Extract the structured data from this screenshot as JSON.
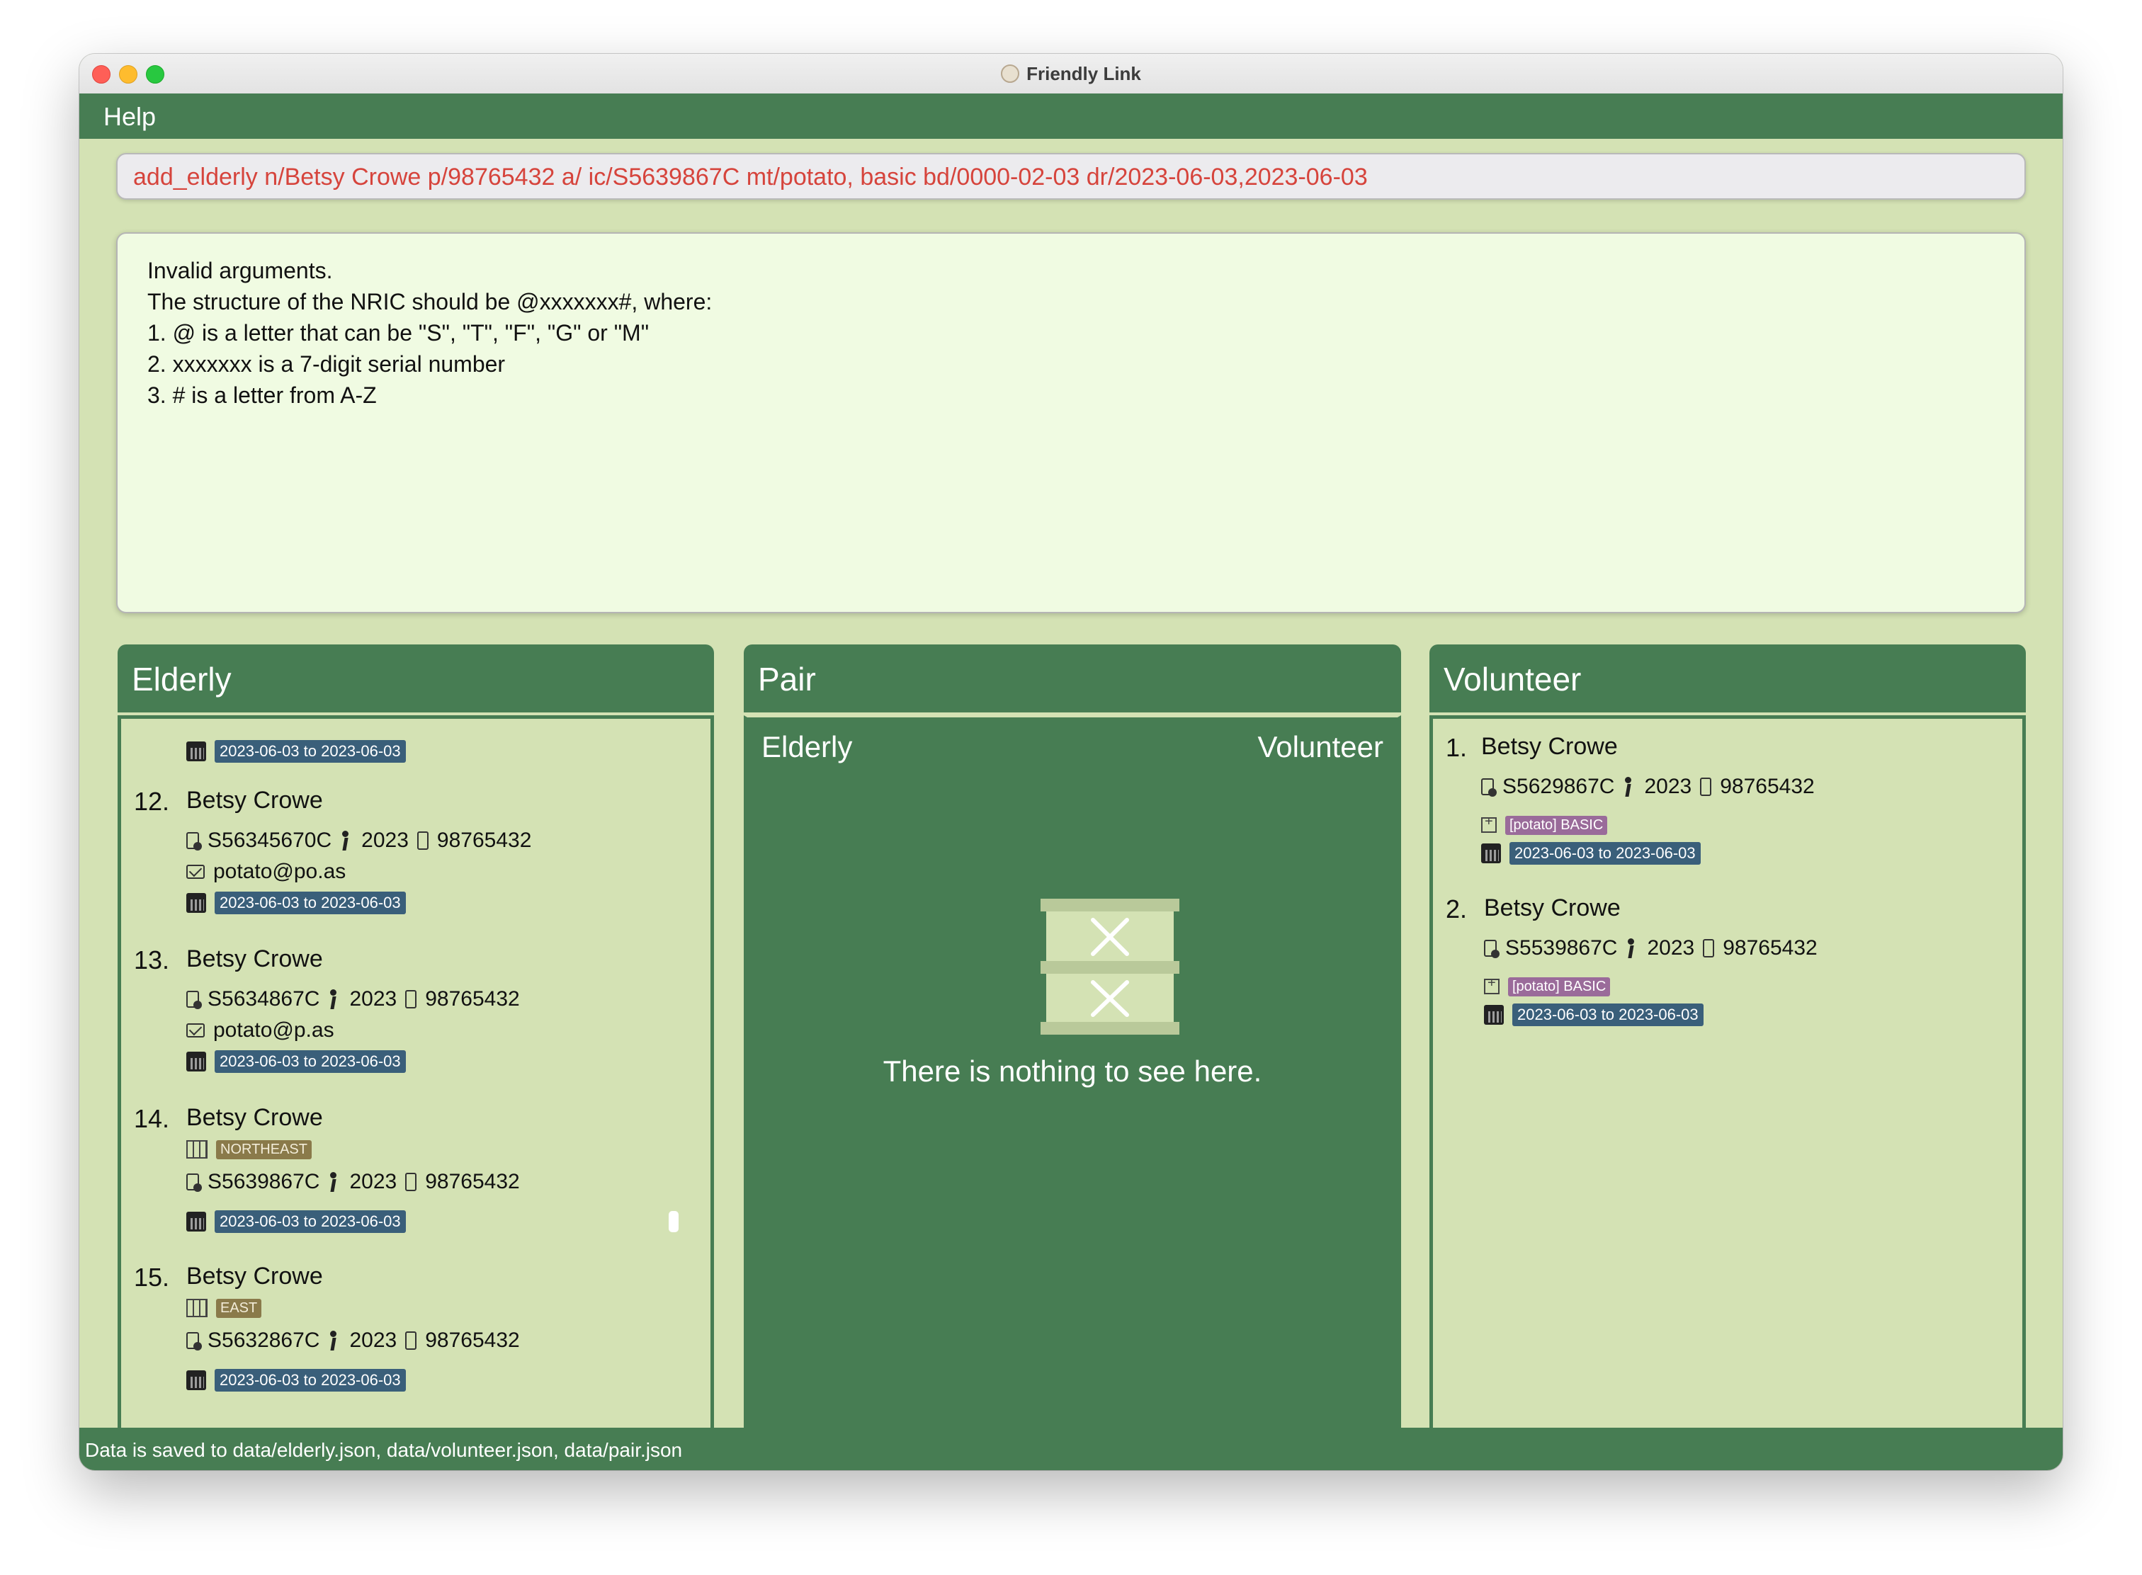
{
  "window": {
    "title": "Friendly Link"
  },
  "menu": {
    "help": "Help"
  },
  "command": {
    "value": "add_elderly n/Betsy Crowe p/98765432 a/ ic/S5639867C mt/potato, basic bd/0000-02-03 dr/2023-06-03,2023-06-03"
  },
  "result": {
    "text": "Invalid arguments.\nThe structure of the NRIC should be @xxxxxxx#, where:\n1. @ is a letter that can be \"S\", \"T\", \"F\", \"G\" or \"M\"\n2. xxxxxxx is a 7-digit serial number\n3. # is a letter from A-Z"
  },
  "elderly_panel": {
    "title": "Elderly",
    "partial_entry": {
      "date_range": "2023-06-03 to 2023-06-03"
    },
    "entries": [
      {
        "index": "12.",
        "name": "Betsy Crowe",
        "nric": "S56345670C",
        "age": "2023",
        "phone": "98765432",
        "email": "potato@po.as",
        "date_range": "2023-06-03 to 2023-06-03"
      },
      {
        "index": "13.",
        "name": "Betsy Crowe",
        "nric": "S5634867C",
        "age": "2023",
        "phone": "98765432",
        "email": "potato@p.as",
        "date_range": "2023-06-03 to 2023-06-03"
      },
      {
        "index": "14.",
        "name": "Betsy Crowe",
        "region": "NORTHEAST",
        "nric": "S5639867C",
        "age": "2023",
        "phone": "98765432",
        "date_range": "2023-06-03 to 2023-06-03"
      },
      {
        "index": "15.",
        "name": "Betsy Crowe",
        "region": "EAST",
        "nric": "S5632867C",
        "age": "2023",
        "phone": "98765432",
        "date_range": "2023-06-03 to 2023-06-03"
      }
    ]
  },
  "pair_panel": {
    "title": "Pair",
    "col_elderly": "Elderly",
    "col_volunteer": "Volunteer",
    "empty_icon": "empty-box-icon",
    "empty_text": "There is nothing to see here."
  },
  "volunteer_panel": {
    "title": "Volunteer",
    "entries": [
      {
        "index": "1.",
        "name": "Betsy Crowe",
        "nric": "S5629867C",
        "age": "2023",
        "phone": "98765432",
        "medical": "[potato] BASIC",
        "date_range": "2023-06-03 to 2023-06-03"
      },
      {
        "index": "2.",
        "name": "Betsy Crowe",
        "nric": "S5539867C",
        "age": "2023",
        "phone": "98765432",
        "medical": "[potato] BASIC",
        "date_range": "2023-06-03 to 2023-06-03"
      }
    ]
  },
  "status": {
    "text": "Data is saved to data/elderly.json, data/volunteer.json, data/pair.json"
  },
  "colors": {
    "accent": "#477d53",
    "background": "#d4e2b4",
    "command_text": "#d6443c",
    "date_tag": "#3a5f7a",
    "medical_tag": "#9a6b9a",
    "region_tag": "#8a7a4a"
  }
}
